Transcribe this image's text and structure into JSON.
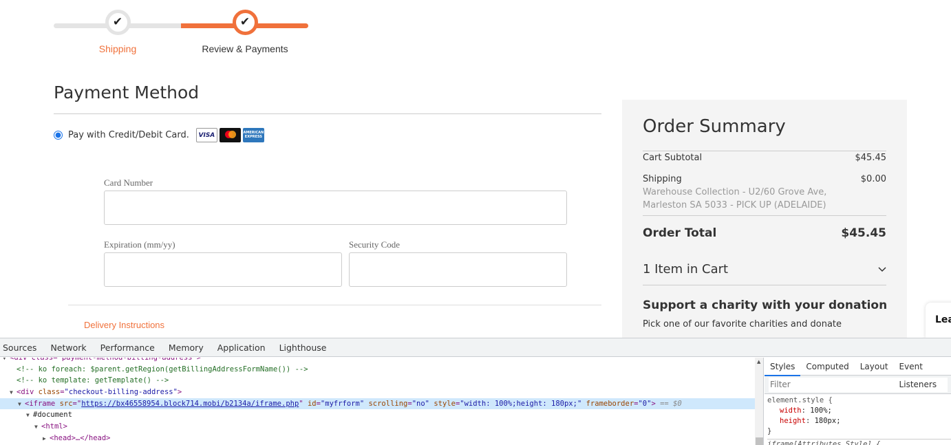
{
  "progress": {
    "steps": [
      {
        "label": "Shipping",
        "state": "complete",
        "icon": "checkmark-icon"
      },
      {
        "label": "Review & Payments",
        "state": "active",
        "icon": "checkmark-icon"
      }
    ],
    "check_glyph": "✔"
  },
  "payment": {
    "title": "Payment Method",
    "option_label": "Pay with Credit/Debit Card.",
    "option_selected": true,
    "card_logos": [
      {
        "name": "visa",
        "text": "VISA"
      },
      {
        "name": "mastercard",
        "text": ""
      },
      {
        "name": "amex",
        "text": "AMERICAN EXPRESS"
      }
    ],
    "fields": {
      "card_number": {
        "label": "Card Number",
        "value": ""
      },
      "expiration": {
        "label": "Expiration (mm/yy)",
        "value": ""
      },
      "security_code": {
        "label": "Security Code",
        "value": ""
      }
    },
    "delivery_link": "Delivery Instructions"
  },
  "summary": {
    "title": "Order Summary",
    "subtotal_label": "Cart Subtotal",
    "subtotal_value": "$45.45",
    "shipping_label": "Shipping",
    "shipping_value": "$0.00",
    "shipping_address_line1": "Warehouse Collection - U2/60 Grove Ave,",
    "shipping_address_line2": "Marleston SA 5033 - PICK UP (ADELAIDE)",
    "total_label": "Order Total",
    "total_value": "$45.45",
    "items_label": "1 Item in Cart",
    "chevron_glyph": "⌄",
    "charity_title": "Support a charity with your donation",
    "charity_sub": "Pick one of our favorite charities and donate"
  },
  "float_widget": {
    "text": "Lea"
  },
  "devtools": {
    "tabs": [
      "Sources",
      "Network",
      "Performance",
      "Memory",
      "Application",
      "Lighthouse"
    ],
    "dom": {
      "line0": "<div class=\"payment-method-billing-address\">",
      "line1": "<!-- ko foreach: $parent.getRegion(getBillingAddressFormName()) -->",
      "line2": "<!-- ko template: getTemplate() -->",
      "line3_tag": "<div ",
      "line3_attr": "class",
      "line3_val": "\"checkout-billing-address\"",
      "line3_end": ">",
      "iframe_tag": "<iframe ",
      "iframe_src_attr": "src",
      "iframe_src": "https://bx46558954.block714.mobi/b2134a/iframe.php",
      "iframe_id_attr": "id",
      "iframe_id": "\"myfrform\"",
      "iframe_scrolling_attr": "scrolling",
      "iframe_scrolling": "\"no\"",
      "iframe_style_attr": "style",
      "iframe_style": "\"width: 100%;height: 180px;\"",
      "iframe_fb_attr": "frameborder",
      "iframe_fb": "\"0\"",
      "iframe_end": ">",
      "selected_marker": "== $0",
      "document": "#document",
      "html": "<html>",
      "head": "<head>…</head>"
    },
    "styles_tabs": [
      "Styles",
      "Computed",
      "Layout",
      "Event Listeners"
    ],
    "filter_placeholder": "Filter",
    "rules": {
      "selector": "element.style {",
      "p1_name": "width",
      "p1_value": "100%;",
      "p2_name": "height",
      "p2_value": "180px;",
      "close": "}",
      "next_selector": "iframe[Attributes Style] {"
    }
  }
}
